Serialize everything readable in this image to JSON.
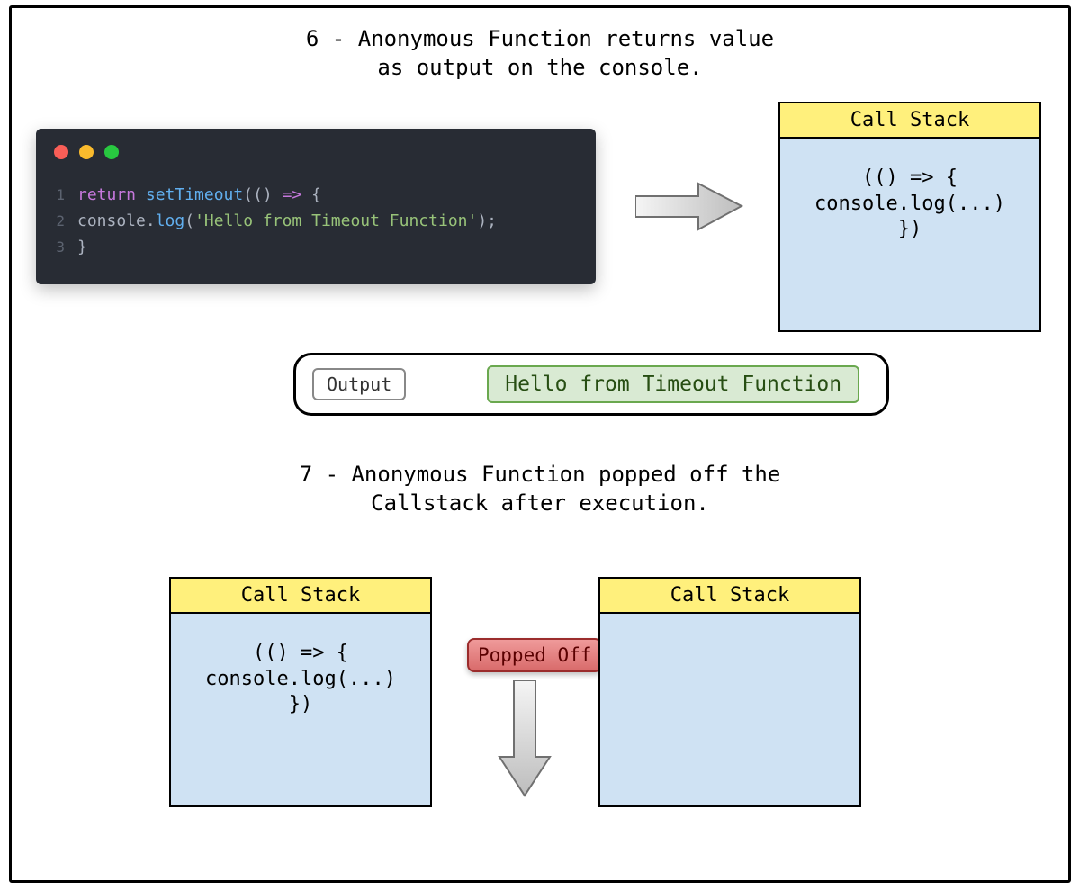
{
  "titles": {
    "step6": "6 - Anonymous Function returns value\nas output on the console.",
    "step7": "7 - Anonymous Function popped off the\nCallstack after execution."
  },
  "code": {
    "lines": [
      {
        "n": "1",
        "tokens": [
          {
            "cls": "kw",
            "t": "return "
          },
          {
            "cls": "fn",
            "t": "setTimeout"
          },
          {
            "cls": "plain",
            "t": "(() "
          },
          {
            "cls": "kw",
            "t": "=>"
          },
          {
            "cls": "plain",
            "t": " {"
          }
        ]
      },
      {
        "n": "2",
        "tokens": [
          {
            "cls": "plain",
            "t": "    console"
          },
          {
            "cls": "dot-op",
            "t": "."
          },
          {
            "cls": "fn",
            "t": "log"
          },
          {
            "cls": "plain",
            "t": "("
          },
          {
            "cls": "str",
            "t": "'Hello from Timeout Function'"
          },
          {
            "cls": "plain",
            "t": ");"
          }
        ]
      },
      {
        "n": "3",
        "tokens": [
          {
            "cls": "plain",
            "t": "  }"
          }
        ]
      }
    ]
  },
  "callstack": {
    "header": "Call Stack",
    "entry": "(() => {\nconsole.log(...)\n})"
  },
  "output": {
    "label": "Output",
    "value": "Hello from Timeout Function"
  },
  "badge": {
    "popped": "Popped Off"
  }
}
